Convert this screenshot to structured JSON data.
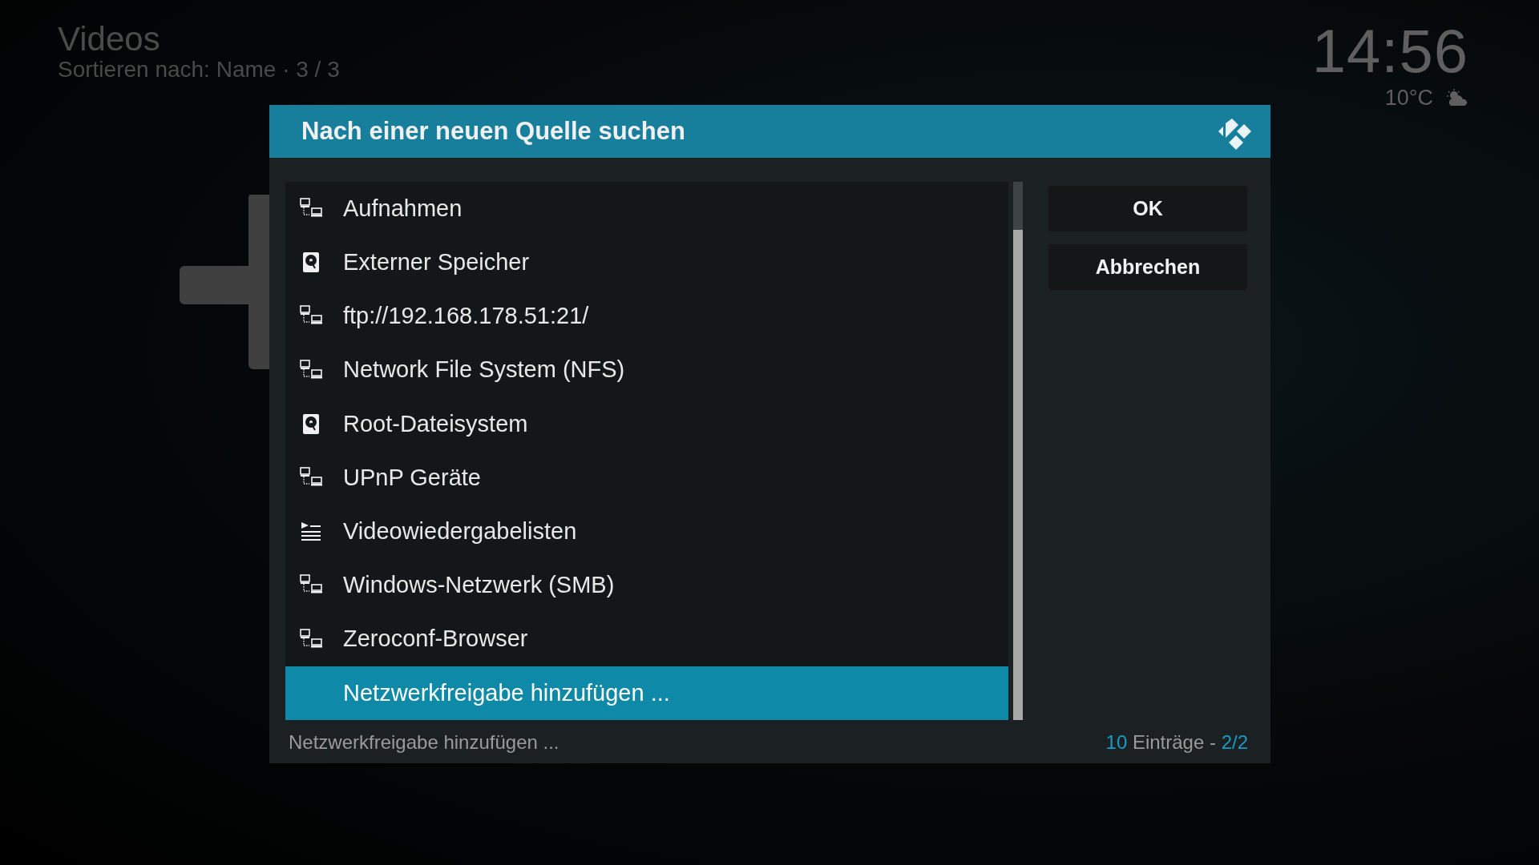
{
  "background": {
    "title": "Videos",
    "subtitle": "Sortieren nach: Name",
    "separator": "·",
    "position": "3 / 3",
    "clock": "14:56",
    "temperature": "10°C"
  },
  "dialog": {
    "title": "Nach einer neuen Quelle suchen",
    "items": [
      {
        "label": "Aufnahmen",
        "kind": "network",
        "selected": false
      },
      {
        "label": "Externer Speicher",
        "kind": "drive",
        "selected": false
      },
      {
        "label": "ftp://192.168.178.51:21/",
        "kind": "network",
        "selected": false
      },
      {
        "label": "Network File System (NFS)",
        "kind": "network",
        "selected": false
      },
      {
        "label": "Root-Dateisystem",
        "kind": "drive",
        "selected": false
      },
      {
        "label": "UPnP Geräte",
        "kind": "network",
        "selected": false
      },
      {
        "label": "Videowiedergabelisten",
        "kind": "playlist",
        "selected": false
      },
      {
        "label": "Windows-Netzwerk (SMB)",
        "kind": "network",
        "selected": false
      },
      {
        "label": "Zeroconf-Browser",
        "kind": "network",
        "selected": false
      },
      {
        "label": "Netzwerkfreigabe hinzufügen ...",
        "kind": "action",
        "selected": true
      }
    ],
    "buttons": [
      "OK",
      "Abbrechen"
    ],
    "footer": {
      "description": "Netzwerkfreigabe hinzufügen ...",
      "count": "10",
      "count_label": "Einträge -",
      "page": "2/2"
    }
  }
}
